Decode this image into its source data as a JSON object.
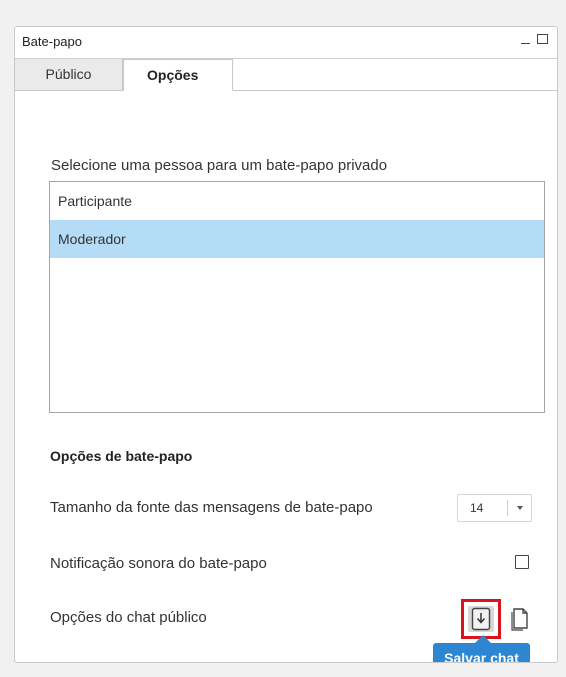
{
  "window": {
    "title": "Bate-papo"
  },
  "tabs": [
    {
      "label": "Público",
      "active": false
    },
    {
      "label": "Opções",
      "active": true
    }
  ],
  "private_chat": {
    "instruction": "Selecione uma pessoa para um bate-papo privado",
    "people": [
      {
        "label": "Participante",
        "selected": false
      },
      {
        "label": "Moderador",
        "selected": true
      }
    ]
  },
  "chat_options": {
    "title": "Opções de bate-papo",
    "font_size_label": "Tamanho da fonte das mensagens de bate-papo",
    "font_size_value": "14",
    "sound_label": "Notificação sonora do bate-papo",
    "sound_enabled": false,
    "public_label": "Opções do chat público",
    "save_tooltip": "Salvar chat"
  },
  "colors": {
    "selected_row": "#b4dcf6",
    "tooltip": "#2d86d2",
    "highlight_border": "#d9151c"
  },
  "icons": [
    "minimize-icon",
    "maximize-icon",
    "dropdown-arrow-icon",
    "save-chat-icon",
    "copy-chat-icon"
  ]
}
